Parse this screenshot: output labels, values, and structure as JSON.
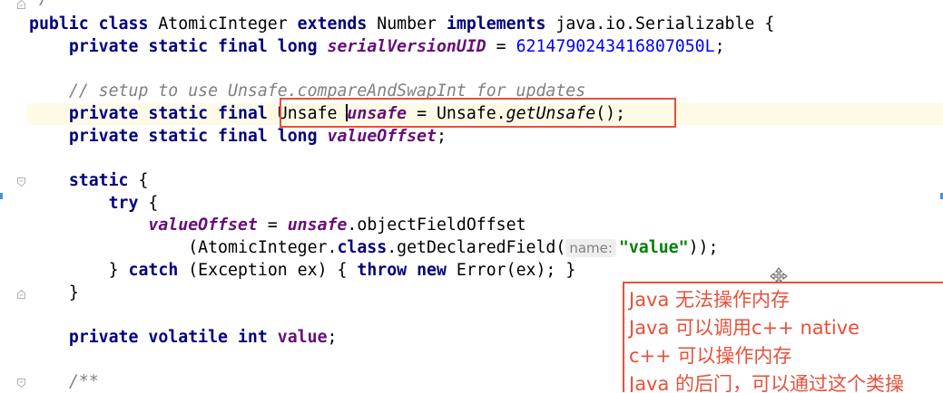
{
  "editor": {
    "lines": {
      "l0": "*/",
      "l1": {
        "kw1": "public class",
        "cls": "AtomicInteger",
        "kw2": "extends",
        "sup": "Number",
        "kw3": "implements",
        "iface": "java.io.Serializable {"
      },
      "l2": {
        "kw": "private static final long",
        "field": "serialVersionUID",
        "eq": " = ",
        "num": "6214790243416807050L",
        "end": ";"
      },
      "l3": {
        "comment": "// setup to use Unsafe.compareAndSwapInt for updates"
      },
      "l4": {
        "kw": "private static final",
        "type": "Unsafe",
        "field": "unsafe",
        "eq": " = Unsafe.",
        "call": "getUnsafe",
        "end": "();"
      },
      "l5": {
        "kw": "private static final long",
        "field": "valueOffset",
        "end": ";"
      },
      "l6": {
        "kw": "static",
        "end": " {"
      },
      "l7": {
        "kw": "try",
        "end": " {"
      },
      "l8": {
        "field": "valueOffset",
        "eq": " = ",
        "obj": "unsafe",
        "call": ".objectFieldOffset"
      },
      "l9": {
        "pre": "(AtomicInteger.",
        "kw": "class",
        "mid": ".getDeclaredField(",
        "hint": "name:",
        "str": "\"value\"",
        "end": "));"
      },
      "l10": {
        "pre": "} ",
        "kw1": "catch",
        "mid": " (Exception ex) { ",
        "kw2": "throw",
        "sp": " ",
        "kw3": "new",
        "end": " Error(ex); }"
      },
      "l11": {
        "text": "}"
      },
      "l12": {
        "kw": "private volatile int",
        "field": "value",
        "end": ";"
      },
      "l13": {
        "comment": "/**"
      }
    }
  },
  "note": {
    "lines": [
      "Java 无法操作内存",
      "Java 可以调用c++  native",
      "c++ 可以操作内存",
      "Java 的后门，可以通过这个类操"
    ]
  },
  "colors": {
    "keyword": "#000080",
    "field": "#660e7a",
    "number": "#0000ff",
    "comment": "#808080",
    "string": "#008000",
    "annotation_red": "#e8503a",
    "current_line": "#fdfbe6"
  },
  "icons": {
    "fold": "fold-marker-icon",
    "cursor": "move-cursor-icon"
  }
}
